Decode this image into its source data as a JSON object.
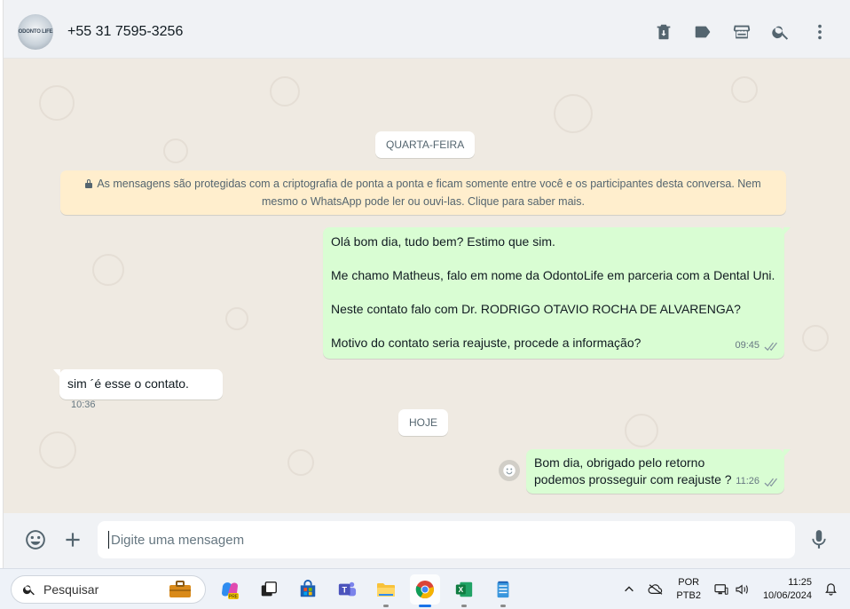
{
  "header": {
    "avatar_text": "ODONTO LIFE",
    "contact_name": "+55 31 7595-3256",
    "icons": [
      "delete-icon",
      "label-icon",
      "catalog-store-icon",
      "search-icon",
      "menu-icon"
    ]
  },
  "chat": {
    "date_wednesday": "QUARTA-FEIRA",
    "encryption_notice": "As mensagens são protegidas com a criptografia de ponta a ponta e ficam somente entre você e os participantes desta conversa. Nem mesmo o WhatsApp pode ler ou ouvi-las. Clique para saber mais.",
    "messages": [
      {
        "direction": "out",
        "lines": [
          "Olá bom dia, tudo bem? Estimo que sim.",
          "Me chamo Matheus, falo em nome da OdontoLife em parceria com a Dental Uni.",
          "Neste contato falo com Dr. RODRIGO OTAVIO ROCHA DE ALVARENGA?",
          "Motivo do contato seria reajuste, procede a informação?"
        ],
        "time": "09:45",
        "status": "read"
      },
      {
        "direction": "in",
        "text": "sim ´é esse o contato.",
        "time": "10:36"
      },
      {
        "direction": "out",
        "lines": [
          "Bom dia, obrigado pelo retorno",
          "podemos prosseguir com reajuste ?"
        ],
        "time": "11:26",
        "status": "read"
      }
    ],
    "date_today": "HOJE"
  },
  "composer": {
    "placeholder": "Digite uma mensagem",
    "icons": [
      "emoji-icon",
      "attach-plus-icon",
      "microphone-icon"
    ]
  },
  "taskbar": {
    "search_label": "Pesquisar",
    "apps": [
      "copilot-icon",
      "task-view-icon",
      "store-icon",
      "teams-icon",
      "file-explorer-icon",
      "chrome-icon",
      "excel-icon",
      "notepad-icon"
    ],
    "lang_top": "POR",
    "lang_bottom": "PTB2",
    "time": "11:25",
    "date": "10/06/2024"
  },
  "colors": {
    "chat_bg": "#efeae2",
    "outgoing_bubble": "#d9fdd3",
    "incoming_bubble": "#ffffff",
    "encryption_bg": "#ffeecd",
    "read_ticks": "#53bdeb"
  }
}
